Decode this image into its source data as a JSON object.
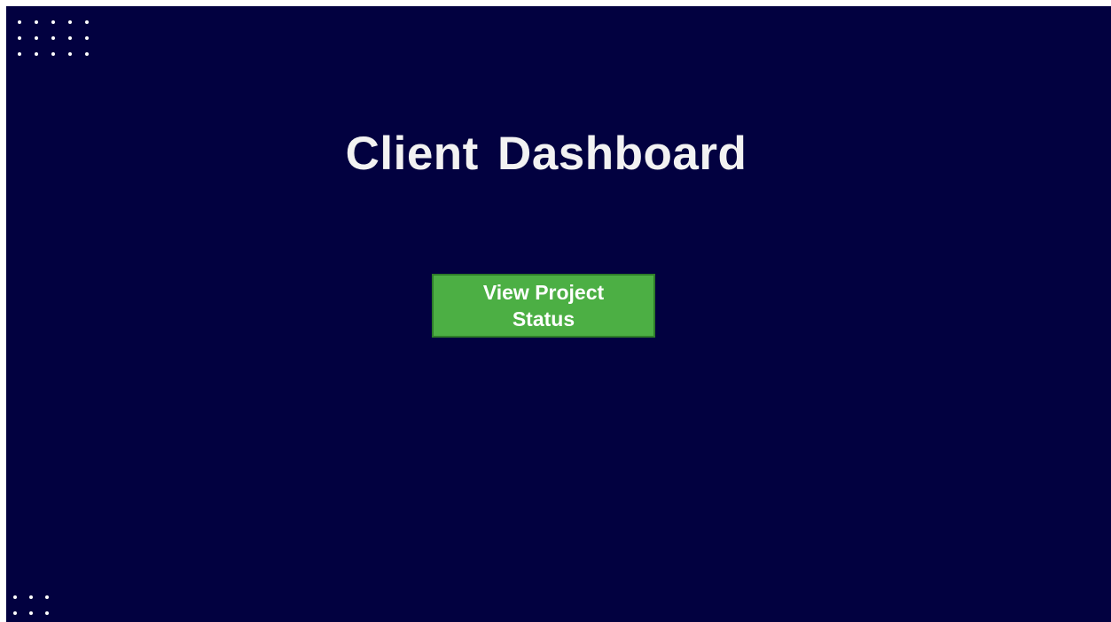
{
  "header": {
    "title": "Client Dashboard"
  },
  "main": {
    "status_button_label": "View Project Status"
  },
  "colors": {
    "background": "#020140",
    "title": "#f2f2f2",
    "button_fill": "#4caf44",
    "button_border": "#2e7d2a",
    "decor_dots": "#ffffff"
  },
  "decor": {
    "top_left_dot_grid": "dot-grid-decoration",
    "bottom_left_dot_grid": "dot-grid-decoration"
  }
}
